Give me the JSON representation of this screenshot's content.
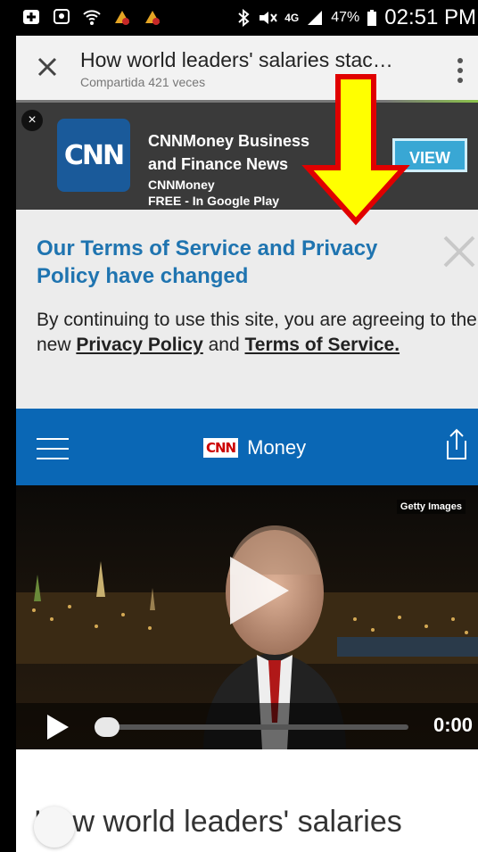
{
  "status_bar": {
    "battery": "47%",
    "network": "4G",
    "time": "02:51 PM"
  },
  "topbar": {
    "title": "How world leaders' salaries stac…",
    "subtitle": "Compartida 421 veces"
  },
  "ad": {
    "logo_text": "CNN",
    "title": "CNNMoney Business and Finance News",
    "publisher": "CNNMoney",
    "price": "FREE - In Google Play",
    "view_label": "VIEW",
    "close_symbol": "×"
  },
  "notice": {
    "title": "Our Terms of Service and Privacy Policy have changed",
    "body_prefix": "By continuing to use this site, you are agreeing to the new ",
    "privacy_link": "Privacy Policy",
    "body_and": " and ",
    "terms_link": "Terms of Service."
  },
  "cnn_header": {
    "logo_text": "CNN",
    "brand": "Money"
  },
  "video": {
    "credit": "Getty Images",
    "time": "0:00",
    "progress": 0
  },
  "article": {
    "headline": "How world leaders' salaries"
  },
  "colors": {
    "notice_title": "#1f74b0",
    "cnn_blue": "#0a67b5",
    "view_button": "#39a7d4",
    "arrow_fill": "#ffff00",
    "arrow_outline": "#e00000"
  }
}
